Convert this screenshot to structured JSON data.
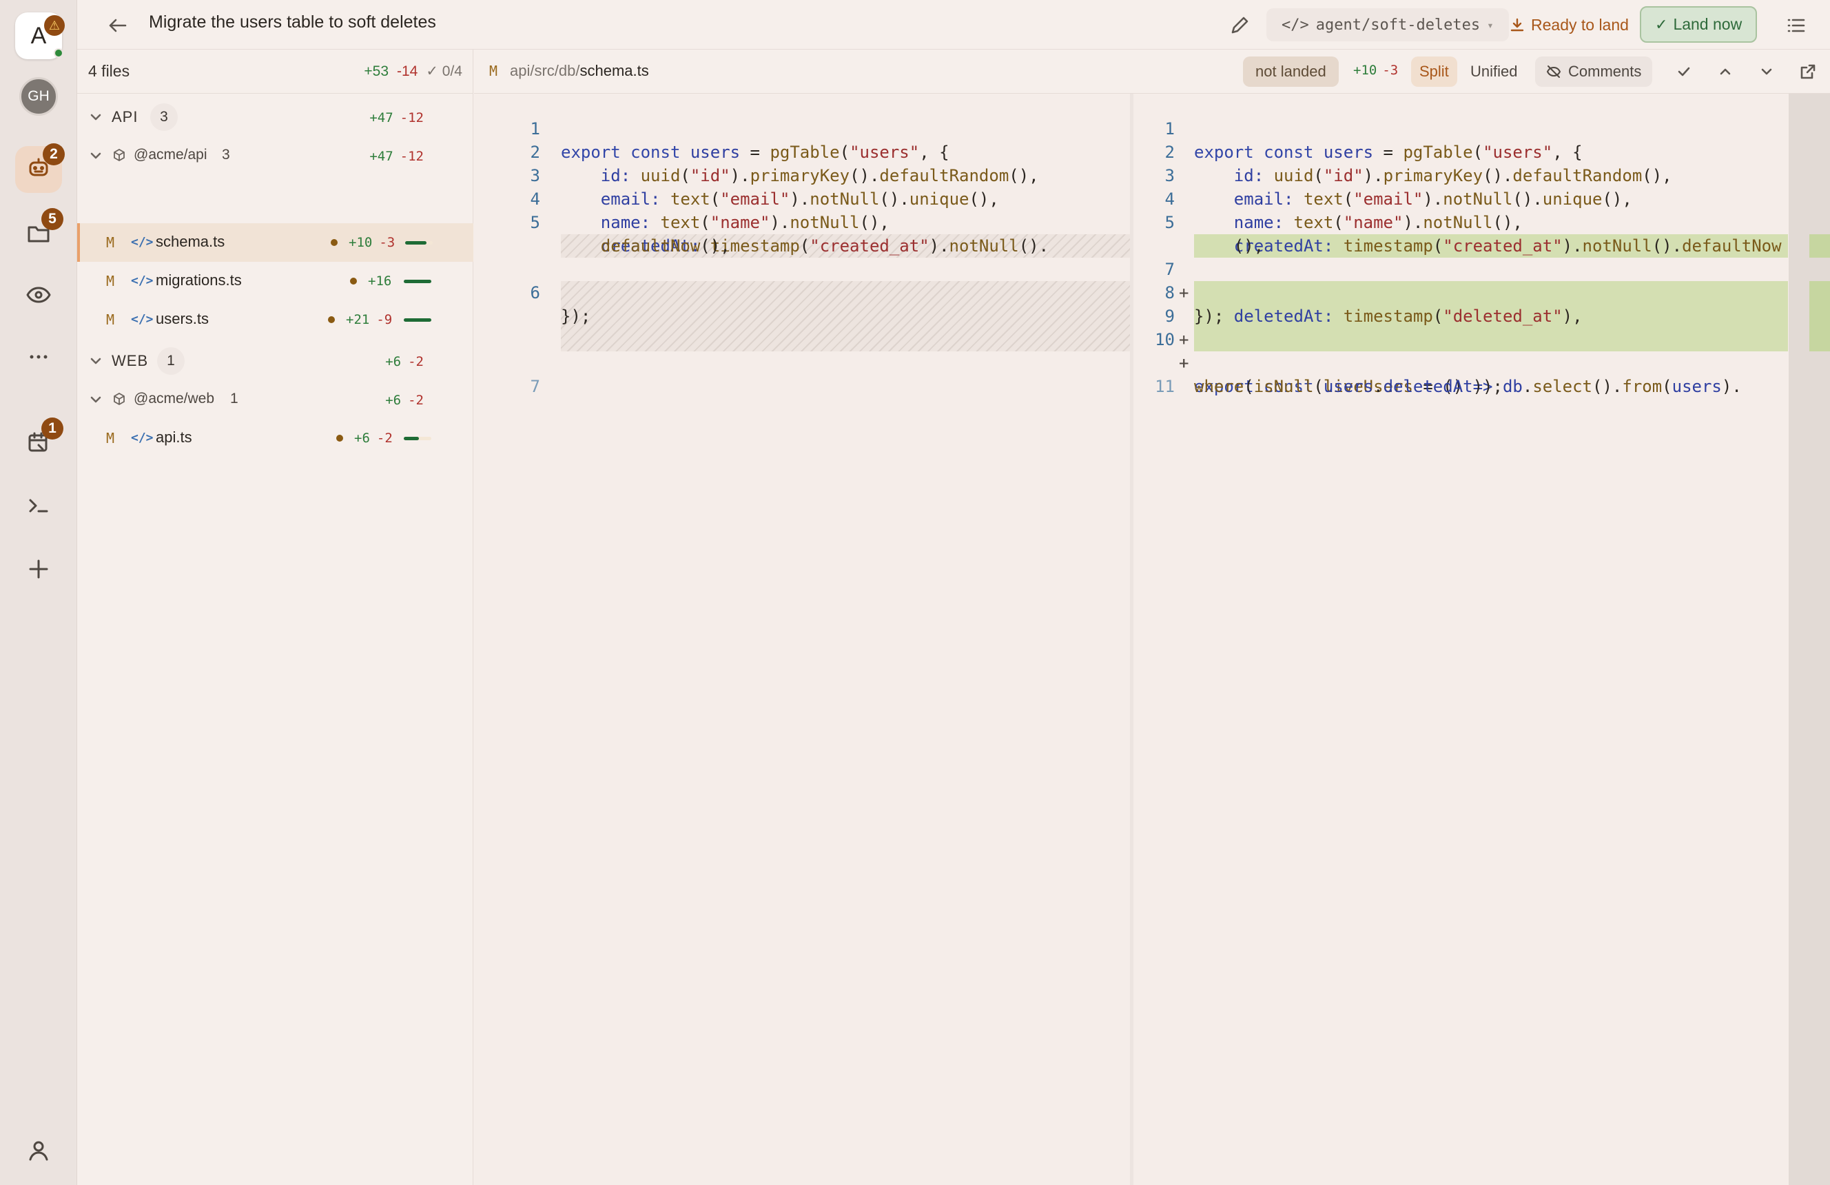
{
  "rail": {
    "logo_letter": "A",
    "avatar_initials": "GH",
    "agents_badge": "2",
    "files_badge": "5",
    "tasks_badge": "1",
    "icons": [
      "logo-icon",
      "robot-icon",
      "folder-icon",
      "eye-icon",
      "more-icon",
      "task-icon",
      "terminal-icon",
      "plus-icon",
      "user-icon"
    ]
  },
  "header": {
    "title": "Migrate the users table to soft deletes",
    "branch": "agent/soft-deletes",
    "ready_label": "Ready to land",
    "land_label": "Land now"
  },
  "tree": {
    "files_label": "4 files",
    "total_add": "+53",
    "total_del": "-14",
    "review_progress": "0/4",
    "groups": [
      {
        "name": "API",
        "count": "3",
        "add": "+47",
        "del": "-12",
        "package": {
          "name": "@acme/api",
          "count": "3",
          "add": "+47",
          "del": "-12"
        },
        "files": [
          {
            "status": "M",
            "name": "schema.ts",
            "add": "+10",
            "del": "-3",
            "bar_fraction": 0.77
          },
          {
            "status": "M",
            "name": "migrations.ts",
            "add": "+16",
            "del": "",
            "bar_fraction": 1.0
          },
          {
            "status": "M",
            "name": "users.ts",
            "add": "+21",
            "del": "-9",
            "bar_fraction": 1.0
          }
        ]
      },
      {
        "name": "WEB",
        "count": "1",
        "add": "+6",
        "del": "-2",
        "package": {
          "name": "@acme/web",
          "count": "1",
          "add": "+6",
          "del": "-2"
        },
        "files": [
          {
            "status": "M",
            "name": "api.ts",
            "add": "+6",
            "del": "-2",
            "bar_fraction": 0.55
          }
        ]
      }
    ]
  },
  "diff": {
    "status": "M",
    "path_prefix": "api/src/db/",
    "path_file": "schema.ts",
    "land_status": "not landed",
    "add": "+10",
    "del": "-3",
    "view_split": "Split",
    "view_unified": "Unified",
    "comments_label": "Comments",
    "left": {
      "line_numbers": [
        "1",
        "2",
        "3",
        "4",
        "5",
        "6",
        "7"
      ],
      "lines": [
        "export const users = pgTable(\"users\", {",
        "    id: uuid(\"id\").primaryKey().defaultRandom(),",
        "    email: text(\"email\").notNull().unique(),",
        "    name: text(\"name\").notNull(),",
        "    createdAt: timestamp(\"created_at\").notNull().",
        "    defaultNow(),",
        "});"
      ]
    },
    "right": {
      "line_numbers": [
        "1",
        "2",
        "3",
        "4",
        "5",
        "7",
        "8",
        "9",
        "10",
        "11"
      ],
      "lines": [
        "export const users = pgTable(\"users\", {",
        "    id: uuid(\"id\").primaryKey().defaultRandom(),",
        "    email: text(\"email\").notNull().unique(),",
        "    name: text(\"name\").notNull(),",
        "    createdAt: timestamp(\"created_at\").notNull().defaultNow",
        "    (),",
        "    deletedAt: timestamp(\"deleted_at\"),",
        "});",
        "",
        "export const liveUsers = () => db.select().from(users).",
        "where(isNull(users.deletedAt));"
      ]
    }
  }
}
